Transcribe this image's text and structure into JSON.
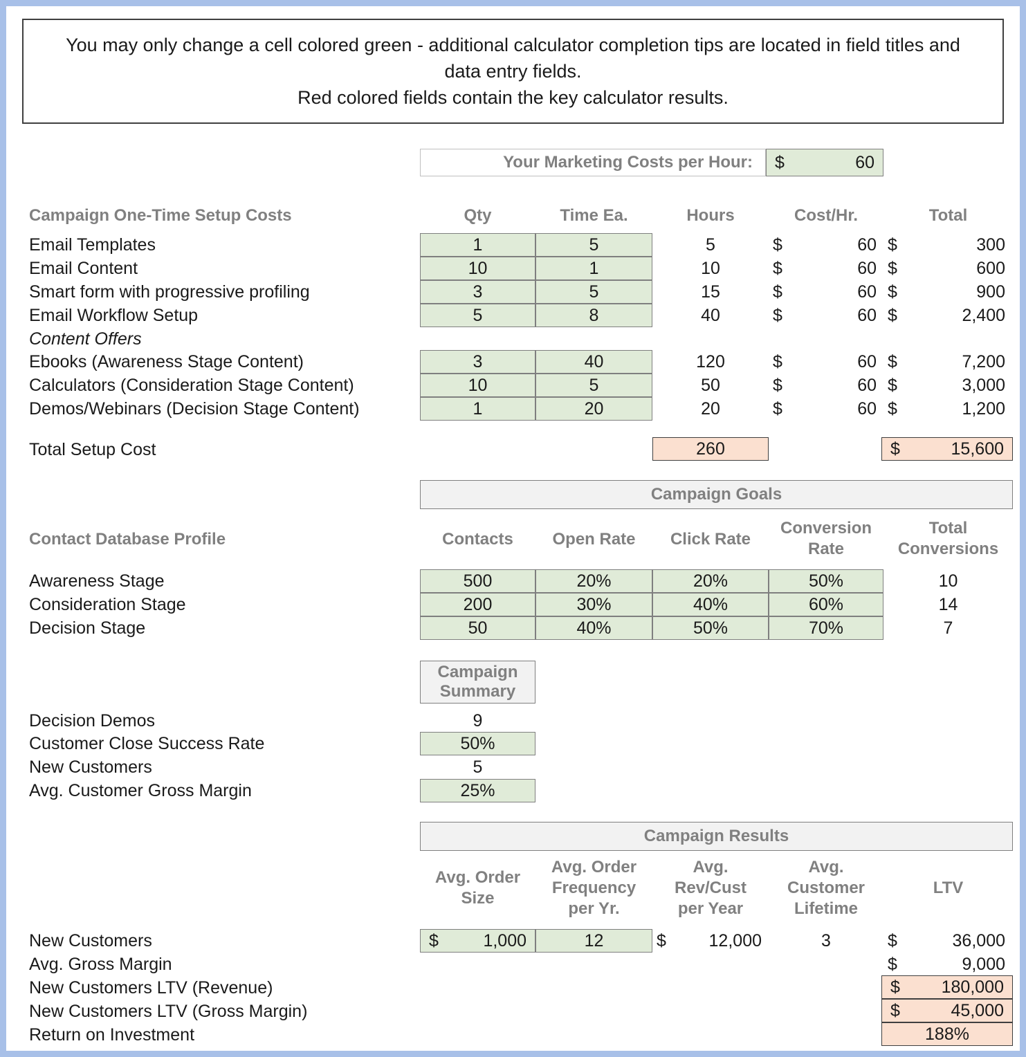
{
  "notice": {
    "line1": "You may only change a cell colored green - additional calculator completion tips are located in field titles and",
    "line2": "data entry fields.",
    "line3": "Red colored fields contain the key calculator results."
  },
  "marketing_cost": {
    "label": "Your Marketing Costs per Hour:",
    "currency": "$",
    "value": "60"
  },
  "setup": {
    "section_title": "Campaign One-Time Setup Costs",
    "headers": {
      "qty": "Qty",
      "time_ea": "Time Ea.",
      "hours": "Hours",
      "cost_hr": "Cost/Hr.",
      "total": "Total"
    },
    "subheading": "Content Offers",
    "rows": [
      {
        "label": "Email Templates",
        "qty": "1",
        "time_ea": "5",
        "hours": "5",
        "cost_cur": "$",
        "cost_hr": "60",
        "total_cur": "$",
        "total": "300"
      },
      {
        "label": "Email Content",
        "qty": "10",
        "time_ea": "1",
        "hours": "10",
        "cost_cur": "$",
        "cost_hr": "60",
        "total_cur": "$",
        "total": "600"
      },
      {
        "label": "Smart form with progressive profiling",
        "qty": "3",
        "time_ea": "5",
        "hours": "15",
        "cost_cur": "$",
        "cost_hr": "60",
        "total_cur": "$",
        "total": "900"
      },
      {
        "label": "Email Workflow Setup",
        "qty": "5",
        "time_ea": "8",
        "hours": "40",
        "cost_cur": "$",
        "cost_hr": "60",
        "total_cur": "$",
        "total": "2,400"
      }
    ],
    "content_rows": [
      {
        "label": "Ebooks (Awareness Stage Content)",
        "qty": "3",
        "time_ea": "40",
        "hours": "120",
        "cost_cur": "$",
        "cost_hr": "60",
        "total_cur": "$",
        "total": "7,200"
      },
      {
        "label": "Calculators (Consideration Stage Content)",
        "qty": "10",
        "time_ea": "5",
        "hours": "50",
        "cost_cur": "$",
        "cost_hr": "60",
        "total_cur": "$",
        "total": "3,000"
      },
      {
        "label": "Demos/Webinars (Decision Stage Content)",
        "qty": "1",
        "time_ea": "20",
        "hours": "20",
        "cost_cur": "$",
        "cost_hr": "60",
        "total_cur": "$",
        "total": "1,200"
      }
    ],
    "total_row": {
      "label": "Total Setup Cost",
      "hours": "260",
      "total_cur": "$",
      "total": "15,600"
    }
  },
  "campaign_goals": {
    "banner": "Campaign Goals",
    "section_title": "Contact Database Profile",
    "headers": {
      "contacts": "Contacts",
      "open_rate": "Open Rate",
      "click_rate": "Click Rate",
      "conversion_rate_l1": "Conversion",
      "conversion_rate_l2": "Rate",
      "total_conversions_l1": "Total",
      "total_conversions_l2": "Conversions"
    },
    "rows": [
      {
        "label": "Awareness Stage",
        "contacts": "500",
        "open_rate": "20%",
        "click_rate": "20%",
        "conversion_rate": "50%",
        "total_conversions": "10"
      },
      {
        "label": "Consideration Stage",
        "contacts": "200",
        "open_rate": "30%",
        "click_rate": "40%",
        "conversion_rate": "60%",
        "total_conversions": "14"
      },
      {
        "label": "Decision Stage",
        "contacts": "50",
        "open_rate": "40%",
        "click_rate": "50%",
        "conversion_rate": "70%",
        "total_conversions": "7"
      }
    ]
  },
  "campaign_summary": {
    "banner_l1": "Campaign",
    "banner_l2": "Summary",
    "rows": [
      {
        "label": "Decision Demos",
        "value": "9",
        "input": false
      },
      {
        "label": "Customer Close Success Rate",
        "value": "50%",
        "input": true
      },
      {
        "label": "New Customers",
        "value": "5",
        "input": false
      },
      {
        "label": "Avg. Customer Gross Margin",
        "value": "25%",
        "input": true
      }
    ]
  },
  "campaign_results": {
    "banner": "Campaign Results",
    "headers": {
      "order_size_l1": "Avg. Order",
      "order_size_l2": "Size",
      "order_freq_l1": "Avg. Order",
      "order_freq_l2": "Frequency",
      "order_freq_l3": "per Yr.",
      "rev_cust_l1": "Avg.",
      "rev_cust_l2": "Rev/Cust",
      "rev_cust_l3": "per Year",
      "cust_lifetime_l1": "Avg.",
      "cust_lifetime_l2": "Customer",
      "cust_lifetime_l3": "Lifetime",
      "ltv": "LTV"
    },
    "new_customers": {
      "label": "New Customers",
      "order_size_cur": "$",
      "order_size": "1,000",
      "order_freq": "12",
      "rev_cust_cur": "$",
      "rev_cust": "12,000",
      "cust_lifetime": "3",
      "ltv_cur": "$",
      "ltv": "36,000"
    },
    "gross_margin": {
      "label": "Avg. Gross Margin",
      "ltv_cur": "$",
      "ltv": "9,000"
    },
    "ltv_revenue": {
      "label": "New Customers LTV (Revenue)",
      "cur": "$",
      "value": "180,000"
    },
    "ltv_gross_margin": {
      "label": "New Customers LTV (Gross Margin)",
      "cur": "$",
      "value": "45,000"
    },
    "roi": {
      "label": "Return on Investment",
      "value": "188%"
    }
  },
  "colors": {
    "input_green": "#e0ebd8",
    "result_red": "#fbe0d0",
    "header_gray": "#808080",
    "page_border": "#a8c0e8"
  }
}
